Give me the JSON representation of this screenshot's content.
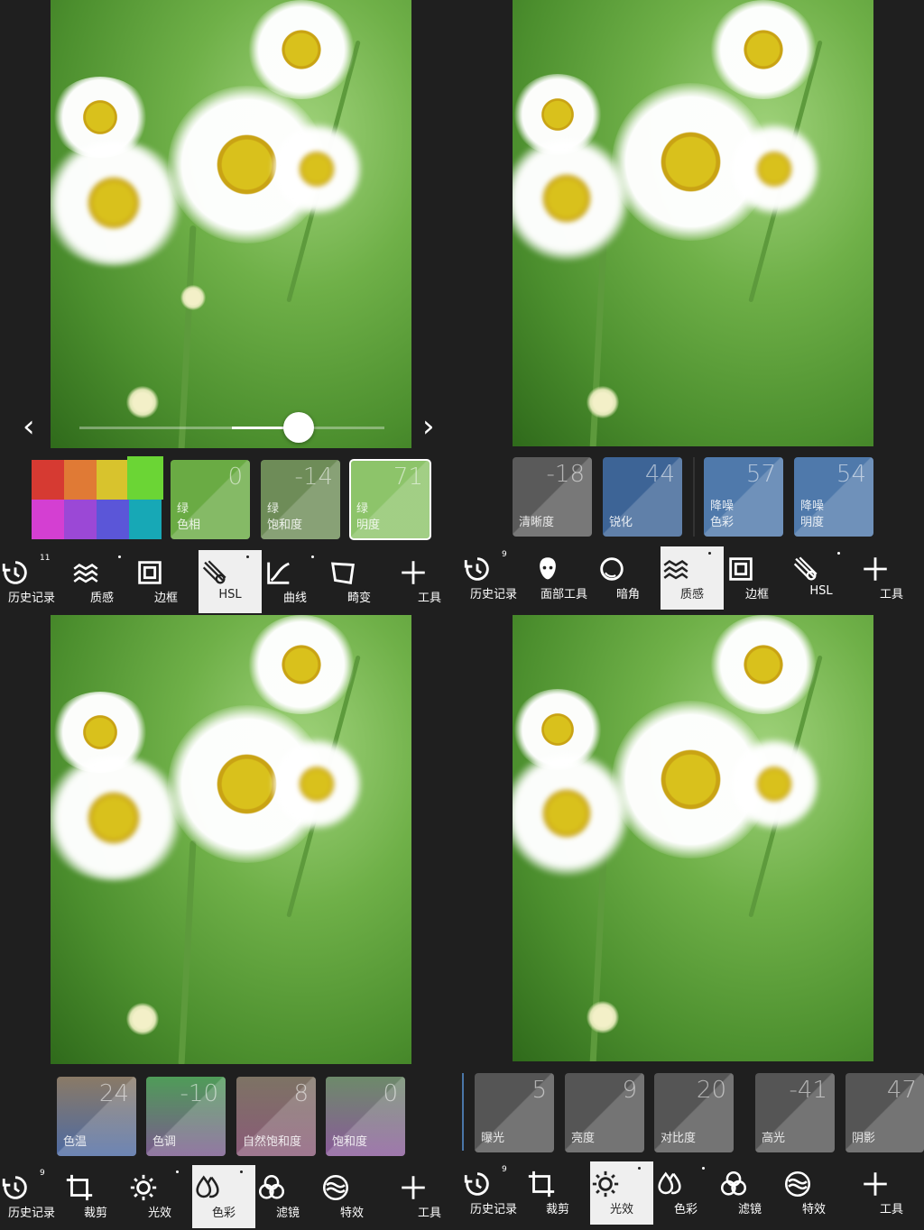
{
  "q1": {
    "slider_value": 0.72,
    "cards": [
      {
        "value": "0",
        "label_line1": "绿",
        "label_line2": "色相"
      },
      {
        "value": "-14",
        "label_line1": "绿",
        "label_line2": "饱和度"
      },
      {
        "value": "71",
        "label_line1": "绿",
        "label_line2": "明度"
      }
    ],
    "tabs": [
      {
        "label": "历史记录",
        "badge": "11",
        "icon": "history-icon"
      },
      {
        "label": "质感",
        "icon": "texture-icon"
      },
      {
        "label": "边框",
        "icon": "frame-icon"
      },
      {
        "label": "HSL",
        "icon": "hsl-icon"
      },
      {
        "label": "曲线",
        "icon": "curve-icon"
      },
      {
        "label": "畸变",
        "icon": "distortion-icon"
      },
      {
        "label": "工具",
        "icon": "plus-icon"
      }
    ]
  },
  "q2": {
    "cards": [
      {
        "value": "-18",
        "label_line1": "清晰度",
        "label_line2": ""
      },
      {
        "value": "44",
        "label_line1": "锐化",
        "label_line2": ""
      },
      {
        "value": "57",
        "label_line1": "降噪",
        "label_line2": "色彩"
      },
      {
        "value": "54",
        "label_line1": "降噪",
        "label_line2": "明度"
      }
    ],
    "tabs": [
      {
        "label": "历史记录",
        "badge": "9",
        "icon": "history-icon"
      },
      {
        "label": "面部工具",
        "icon": "face-icon"
      },
      {
        "label": "暗角",
        "icon": "vignette-icon"
      },
      {
        "label": "质感",
        "icon": "texture-icon"
      },
      {
        "label": "边框",
        "icon": "frame-icon"
      },
      {
        "label": "HSL",
        "icon": "hsl-icon"
      },
      {
        "label": "工具",
        "icon": "plus-icon"
      }
    ]
  },
  "q3": {
    "cards": [
      {
        "value": "24",
        "label_line1": "色温"
      },
      {
        "value": "-10",
        "label_line1": "色调"
      },
      {
        "value": "8",
        "label_line1": "自然饱和度"
      },
      {
        "value": "0",
        "label_line1": "饱和度"
      }
    ],
    "tabs": [
      {
        "label": "历史记录",
        "badge": "9",
        "icon": "history-icon"
      },
      {
        "label": "裁剪",
        "icon": "crop-icon"
      },
      {
        "label": "光效",
        "icon": "light-icon"
      },
      {
        "label": "色彩",
        "icon": "color-icon"
      },
      {
        "label": "滤镜",
        "icon": "filter-icon"
      },
      {
        "label": "特效",
        "icon": "effects-icon"
      },
      {
        "label": "工具",
        "icon": "plus-icon"
      }
    ]
  },
  "q4": {
    "cards": [
      {
        "value": "5",
        "label_line1": "曝光"
      },
      {
        "value": "9",
        "label_line1": "亮度"
      },
      {
        "value": "20",
        "label_line1": "对比度"
      },
      {
        "value": "-41",
        "label_line1": "高光"
      },
      {
        "value": "47",
        "label_line1": "阴影"
      }
    ],
    "tabs": [
      {
        "label": "历史记录",
        "badge": "9",
        "icon": "history-icon"
      },
      {
        "label": "裁剪",
        "icon": "crop-icon"
      },
      {
        "label": "光效",
        "icon": "light-icon"
      },
      {
        "label": "色彩",
        "icon": "color-icon"
      },
      {
        "label": "滤镜",
        "icon": "filter-icon"
      },
      {
        "label": "特效",
        "icon": "effects-icon"
      },
      {
        "label": "工具",
        "icon": "plus-icon"
      }
    ]
  },
  "colors": {
    "background": "#1f1f1f",
    "active_tab": "#efefef",
    "blue_card": "#3d6496",
    "gray_card": "#5a5a5a",
    "green_card": "#6fae43"
  }
}
